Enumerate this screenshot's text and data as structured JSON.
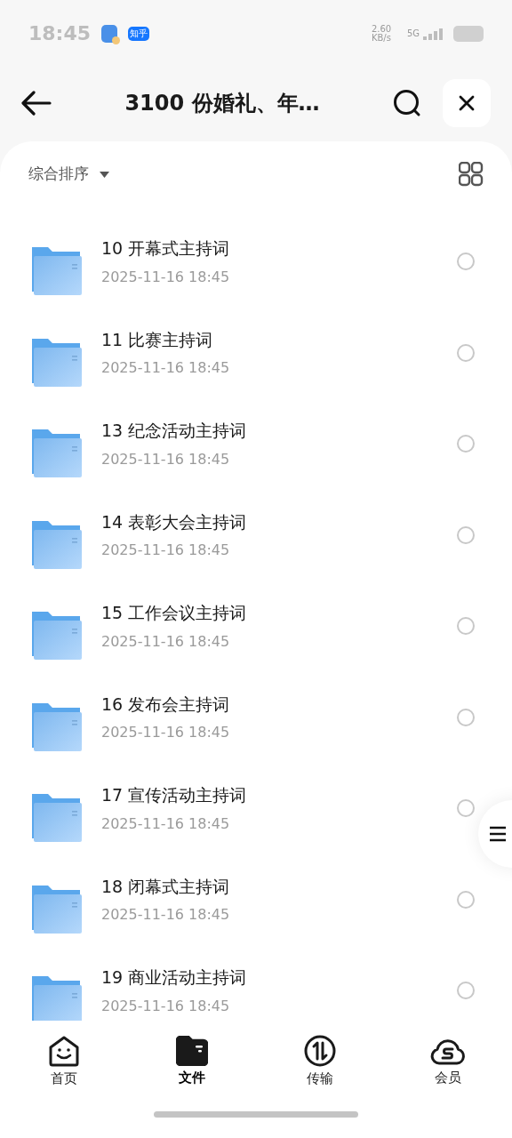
{
  "status_bar": {
    "time": "18:45",
    "app_badge": "知乎",
    "net_speed": "2.60 KB/s",
    "network": "5G"
  },
  "header": {
    "title": "3100 份婚礼、年…"
  },
  "sort": {
    "label": "综合排序"
  },
  "files": [
    {
      "name": "10 开幕式主持词",
      "date": "2025-11-16 18:45",
      "selected": false
    },
    {
      "name": "11 比赛主持词",
      "date": "2025-11-16 18:45",
      "selected": false
    },
    {
      "name": "13 纪念活动主持词",
      "date": "2025-11-16 18:45",
      "selected": false
    },
    {
      "name": "14 表彰大会主持词",
      "date": "2025-11-16 18:45",
      "selected": false
    },
    {
      "name": "15 工作会议主持词",
      "date": "2025-11-16 18:45",
      "selected": false
    },
    {
      "name": "16 发布会主持词",
      "date": "2025-11-16 18:45",
      "selected": false
    },
    {
      "name": "17 宣传活动主持词",
      "date": "2025-11-16 18:45",
      "selected": false
    },
    {
      "name": "18 闭幕式主持词",
      "date": "2025-11-16 18:45",
      "selected": false
    },
    {
      "name": "19 商业活动主持词",
      "date": "2025-11-16 18:45",
      "selected": false
    }
  ],
  "nav": [
    {
      "kind": "home",
      "label": "首页",
      "selected": false
    },
    {
      "kind": "files",
      "label": "文件",
      "selected": true
    },
    {
      "kind": "transfer",
      "label": "传输",
      "selected": false
    },
    {
      "kind": "vip",
      "label": "会员",
      "selected": false
    }
  ]
}
